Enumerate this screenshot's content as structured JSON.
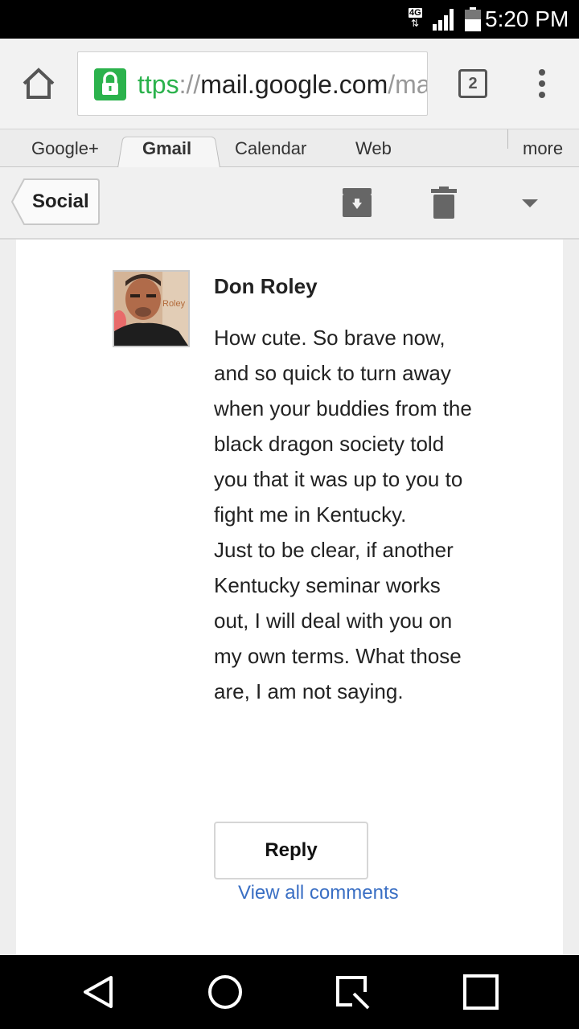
{
  "status_bar": {
    "network": "4G",
    "network_arrows": "⇅",
    "signal_level": 4,
    "battery_level": 0.55,
    "time": "5:20 PM"
  },
  "browser": {
    "url_scheme": "ttps",
    "url_sep": "://",
    "url_host": "mail.google.com",
    "url_rest": "/mail/",
    "tab_count": "2",
    "icons": {
      "home": "home-icon",
      "lock": "lock-icon",
      "menu": "overflow-menu-icon"
    }
  },
  "google_bar": {
    "items": [
      "Google+",
      "Gmail",
      "Calendar",
      "Web"
    ],
    "active": "Gmail",
    "more": "more"
  },
  "gmail_bar": {
    "back_label": "Social",
    "icons": {
      "archive": "archive-icon",
      "delete": "trash-icon",
      "dropdown": "chevron-down-icon"
    }
  },
  "comment": {
    "author": "Don Roley",
    "avatar_text": "Roley",
    "lines": [
      "How cute. So brave now, and so quick to turn away when your buddies from the black dragon society told you that it was up to you to fight me in Kentucky.",
      "Just to be clear, if another Kentucky seminar works out, I will deal with you on my own terms. What those are, I am not saying."
    ],
    "reply_label": "Reply",
    "view_all_label": "View all comments"
  },
  "colors": {
    "link": "#3a6fc4",
    "secure": "#2bb24c"
  }
}
